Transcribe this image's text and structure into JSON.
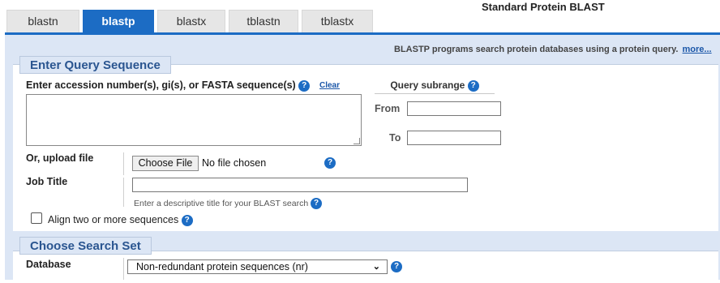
{
  "tabs": [
    {
      "label": "blastn",
      "active": false
    },
    {
      "label": "blastp",
      "active": true
    },
    {
      "label": "blastx",
      "active": false
    },
    {
      "label": "tblastn",
      "active": false
    },
    {
      "label": "tblastx",
      "active": false
    }
  ],
  "page_title": "Standard Protein BLAST",
  "description": {
    "text": "BLASTP programs search protein databases using a protein query.",
    "more_link": "more..."
  },
  "query_section": {
    "legend": "Enter Query Sequence",
    "sequence_label": "Enter accession number(s), gi(s), or FASTA sequence(s)",
    "clear_link": "Clear",
    "sequence_value": "",
    "subrange_title": "Query subrange",
    "from_label": "From",
    "to_label": "To",
    "from_value": "",
    "to_value": "",
    "upload_label": "Or, upload file",
    "choose_file_button": "Choose File",
    "no_file_text": "No file chosen",
    "job_title_label": "Job Title",
    "job_title_value": "",
    "job_title_hint": "Enter a descriptive title for your BLAST search",
    "align_label": "Align two or more sequences",
    "align_checked": false
  },
  "search_set": {
    "legend": "Choose Search Set",
    "database_label": "Database",
    "database_value": "Non-redundant protein sequences (nr)"
  },
  "colors": {
    "accent": "#1c6cc4",
    "panel_bg": "#dce6f5",
    "link": "#1a56a8"
  },
  "icons": [
    "help-icon",
    "chevron-down-icon",
    "resize-handle-icon"
  ]
}
